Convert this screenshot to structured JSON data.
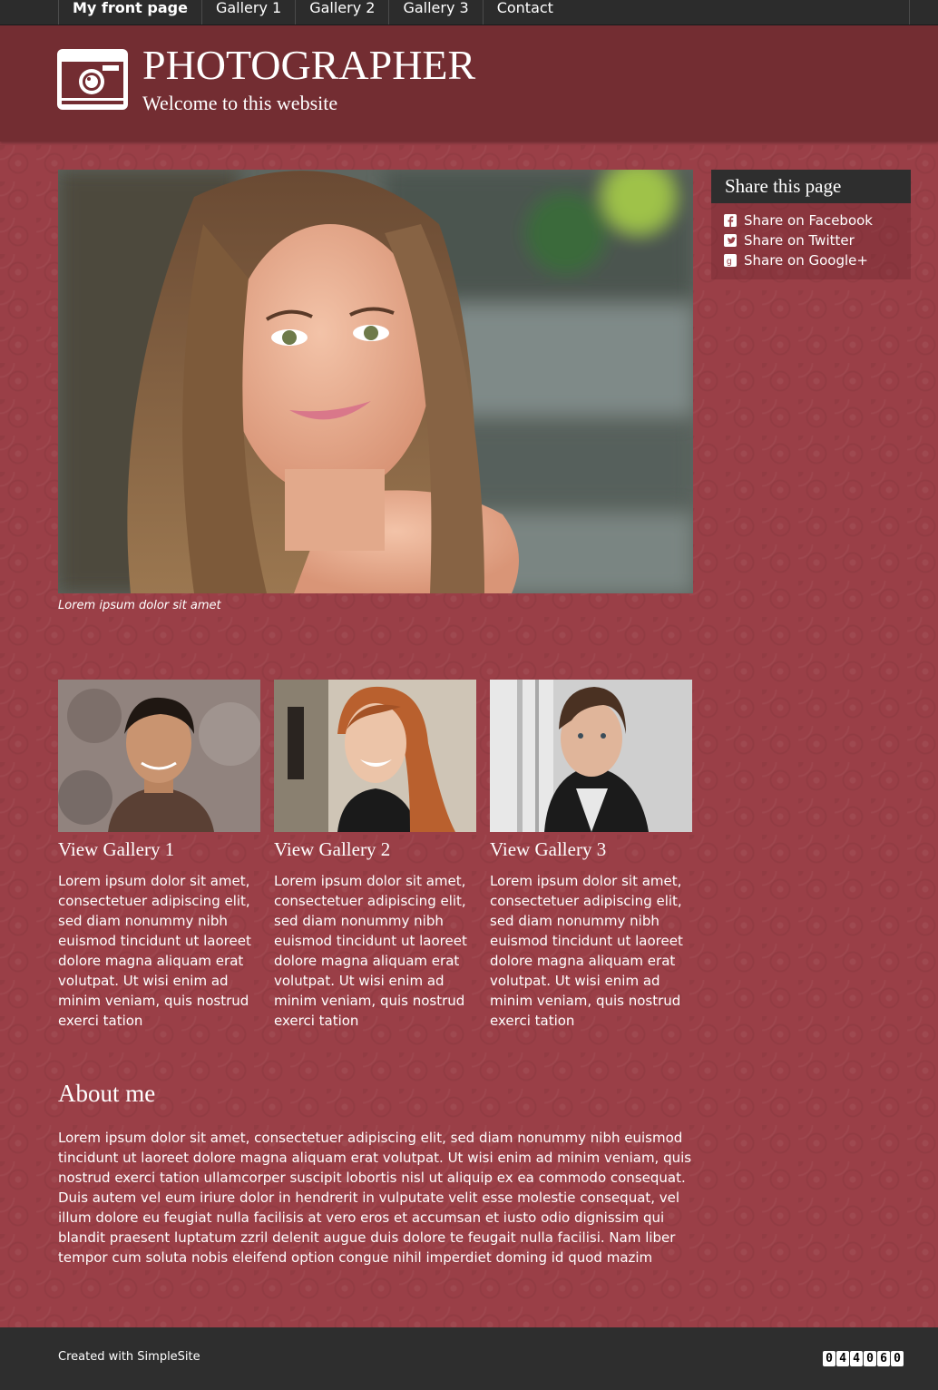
{
  "nav": {
    "items": [
      "My front page",
      "Gallery 1",
      "Gallery 2",
      "Gallery 3",
      "Contact"
    ]
  },
  "header": {
    "title": "PHOTOGRAPHER",
    "subtitle": "Welcome to this website",
    "logo_icon": "camera-icon"
  },
  "hero": {
    "caption": "Lorem ipsum dolor sit amet"
  },
  "share": {
    "title": "Share this page",
    "links": [
      "Share on Facebook",
      "Share on Twitter",
      "Share on Google+"
    ]
  },
  "galleries": [
    {
      "link": "View Gallery 1",
      "text": "Lorem ipsum dolor sit amet, consectetuer adipiscing elit, sed diam nonummy nibh euismod tincidunt ut laoreet dolore magna aliquam erat volutpat. Ut wisi enim ad minim veniam, quis nostrud exerci tation"
    },
    {
      "link": "View Gallery 2",
      "text": "Lorem ipsum dolor sit amet, consectetuer adipiscing elit, sed diam nonummy nibh euismod tincidunt ut laoreet dolore magna aliquam erat volutpat. Ut wisi enim ad minim veniam, quis nostrud exerci tation"
    },
    {
      "link": "View Gallery 3",
      "text": "Lorem ipsum dolor sit amet, consectetuer adipiscing elit, sed diam nonummy nibh euismod tincidunt ut laoreet dolore magna aliquam erat volutpat. Ut wisi enim ad minim veniam, quis nostrud exerci tation"
    }
  ],
  "about": {
    "title": "About me",
    "text": "Lorem ipsum dolor sit amet, consectetuer adipiscing elit, sed diam nonummy nibh euismod tincidunt ut laoreet dolore magna aliquam erat volutpat. Ut wisi enim ad minim veniam, quis nostrud exerci tation ullamcorper suscipit lobortis nisl ut aliquip ex ea commodo consequat. Duis autem vel eum iriure dolor in hendrerit in vulputate velit esse molestie consequat, vel illum dolore eu feugiat nulla facilisis at vero eros et accumsan et iusto odio dignissim qui blandit praesent luptatum zzril delenit augue duis dolore te feugait nulla facilisi. Nam liber tempor cum soluta nobis eleifend option congue nihil imperdiet doming id quod mazim"
  },
  "footer": {
    "link": "Created with SimpleSite",
    "counter": [
      "0",
      "4",
      "4",
      "0",
      "6",
      "0"
    ]
  },
  "colors": {
    "nav_bg": "#2c2c2c",
    "header_bg": "#732d32",
    "page_bg": "#9a3f47",
    "footer_bg": "#2e2e2e"
  }
}
